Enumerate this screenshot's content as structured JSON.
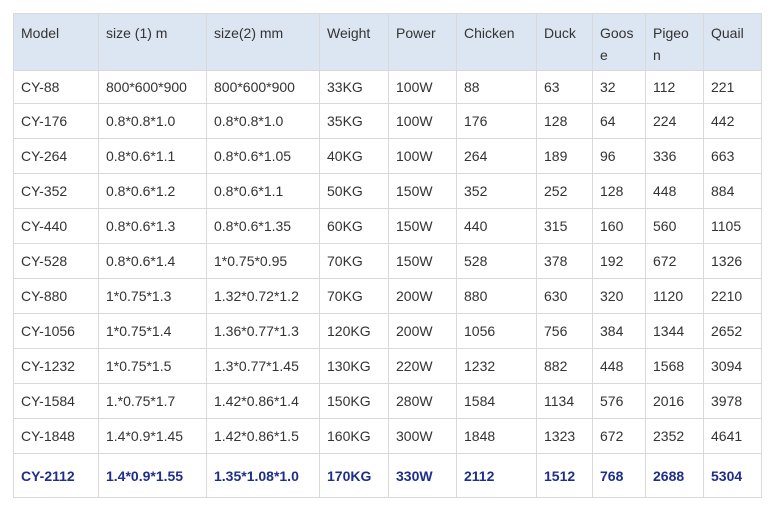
{
  "table": {
    "columns": [
      "Model",
      "size (1) m",
      "size(2) mm",
      "Weight",
      "Power",
      "Chicken",
      "Duck",
      "Goose",
      "Pigeon",
      "Quail"
    ],
    "rows": [
      [
        "CY-88",
        "800*600*900",
        "800*600*900",
        "33KG",
        "100W",
        "88",
        "63",
        "32",
        "112",
        "221"
      ],
      [
        "CY-176",
        "0.8*0.8*1.0",
        "0.8*0.8*1.0",
        "35KG",
        "100W",
        "176",
        "128",
        "64",
        "224",
        "442"
      ],
      [
        "CY-264",
        "0.8*0.6*1.1",
        "0.8*0.6*1.05",
        "40KG",
        "100W",
        "264",
        "189",
        "96",
        "336",
        "663"
      ],
      [
        "CY-352",
        "0.8*0.6*1.2",
        "0.8*0.6*1.1",
        "50KG",
        "150W",
        "352",
        "252",
        "128",
        "448",
        "884"
      ],
      [
        "CY-440",
        "0.8*0.6*1.3",
        "0.8*0.6*1.35",
        "60KG",
        "150W",
        "440",
        "315",
        "160",
        "560",
        "1105"
      ],
      [
        "CY-528",
        "0.8*0.6*1.4",
        "1*0.75*0.95",
        "70KG",
        "150W",
        "528",
        "378",
        "192",
        "672",
        "1326"
      ],
      [
        "CY-880",
        "1*0.75*1.3",
        "1.32*0.72*1.2",
        "70KG",
        "200W",
        "880",
        "630",
        "320",
        "1120",
        "2210"
      ],
      [
        "CY-1056",
        "1*0.75*1.4",
        "1.36*0.77*1.3",
        "120KG",
        "200W",
        "1056",
        "756",
        "384",
        "1344",
        "2652"
      ],
      [
        "CY-1232",
        "1*0.75*1.5",
        "1.3*0.77*1.45",
        "130KG",
        "220W",
        "1232",
        "882",
        "448",
        "1568",
        "3094"
      ],
      [
        "CY-1584",
        "1.*0.75*1.7",
        "1.42*0.86*1.4",
        "150KG",
        "280W",
        "1584",
        "1134",
        "576",
        "2016",
        "3978"
      ],
      [
        "CY-1848",
        "1.4*0.9*1.45",
        "1.42*0.86*1.5",
        "160KG",
        "300W",
        "1848",
        "1323",
        "672",
        "2352",
        "4641"
      ],
      [
        "CY-2112",
        "1.4*0.9*1.55",
        "1.35*1.08*1.0",
        "170KG",
        "330W",
        "2112",
        "1512",
        "768",
        "2688",
        "5304"
      ]
    ]
  },
  "colors": {
    "header_background": "#dce6f2",
    "border": "#d9d9d9",
    "text": "#333333",
    "highlight_row_text": "#1f2e8a"
  }
}
